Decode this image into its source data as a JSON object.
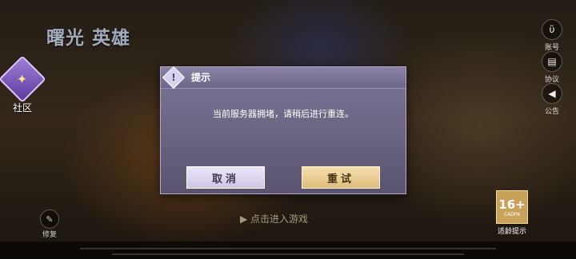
{
  "logo": {
    "text": "曙光 英雄"
  },
  "community": {
    "label": "社区",
    "icon": "community-star-icon"
  },
  "side_buttons": [
    {
      "label": "账号",
      "icon": "account-icon"
    },
    {
      "label": "协议",
      "icon": "agreement-icon"
    },
    {
      "label": "公告",
      "icon": "announcement-icon"
    }
  ],
  "repair": {
    "label": "修复",
    "icon": "wrench-icon"
  },
  "enter_game": "点击进入游戏",
  "age_rating": {
    "value": "16+",
    "sub": "CADPA",
    "label": "适龄提示"
  },
  "dialog": {
    "title": "提示",
    "message": "当前服务器拥堵，请稍后进行重连。",
    "cancel_label": "取消",
    "retry_label": "重试"
  },
  "colors": {
    "dialog_bg": "#6b6482",
    "cancel_bg": "#e4ddf2",
    "retry_bg": "#ecd095"
  }
}
